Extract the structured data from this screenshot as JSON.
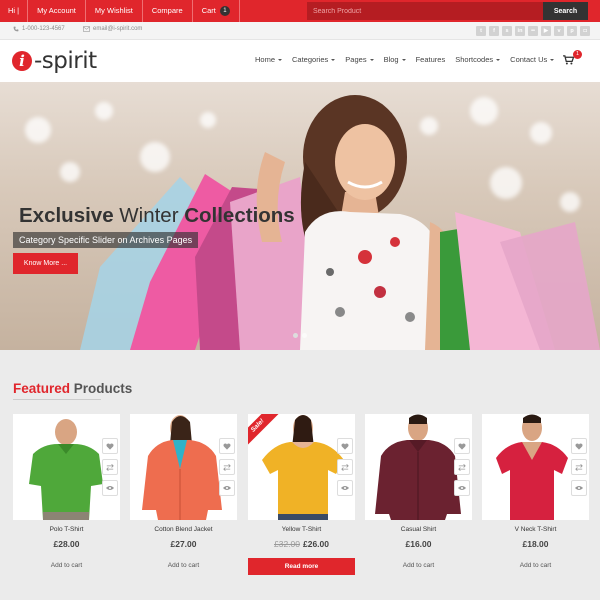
{
  "topbar": {
    "links": [
      "Hi |",
      "My Account",
      "My Wishlist",
      "Compare",
      "Cart"
    ],
    "cart_count": "1",
    "search_placeholder": "Search Product",
    "search_button": "Search"
  },
  "contact": {
    "phone": "1-000-123-4567",
    "email": "email@i-spirit.com"
  },
  "socials": [
    "twitter",
    "facebook",
    "skype",
    "linkedin",
    "flickr",
    "youtube",
    "vimeo",
    "pinterest",
    "instagram"
  ],
  "header": {
    "logo_text": "-spirit",
    "logo_mark": "i",
    "nav": [
      {
        "label": "Home",
        "caret": true
      },
      {
        "label": "Categories",
        "caret": true
      },
      {
        "label": "Pages",
        "caret": true
      },
      {
        "label": "Blog",
        "caret": true
      },
      {
        "label": "Features",
        "caret": false
      },
      {
        "label": "Shortcodes",
        "caret": true
      },
      {
        "label": "Contact Us",
        "caret": true
      }
    ],
    "cart_badge": "1"
  },
  "hero": {
    "title_bold_1": "Exclusive",
    "title_light": " Winter ",
    "title_bold_2": "Collections",
    "subtitle": "Category Specific Slider on Archives Pages",
    "button": "Know More ..."
  },
  "featured": {
    "title_highlight": "Featured",
    "title_rest": " Products"
  },
  "products": [
    {
      "name": "Polo T-Shirt",
      "price": "£28.00",
      "old_price": "",
      "action": "Add to cart",
      "sale": false
    },
    {
      "name": "Cotton Blend Jacket",
      "price": "£27.00",
      "old_price": "",
      "action": "Add to cart",
      "sale": false
    },
    {
      "name": "Yellow T-Shirt",
      "price": "£26.00",
      "old_price": "£32.00",
      "action": "Read more",
      "sale": true,
      "sale_label": "Sale!"
    },
    {
      "name": "Casual Shirt",
      "price": "£16.00",
      "old_price": "",
      "action": "Add to cart",
      "sale": false
    },
    {
      "name": "V Neck T-Shirt",
      "price": "£18.00",
      "old_price": "",
      "action": "Add to cart",
      "sale": false
    }
  ],
  "colors": {
    "accent": "#e0262c",
    "dark": "#333333"
  }
}
